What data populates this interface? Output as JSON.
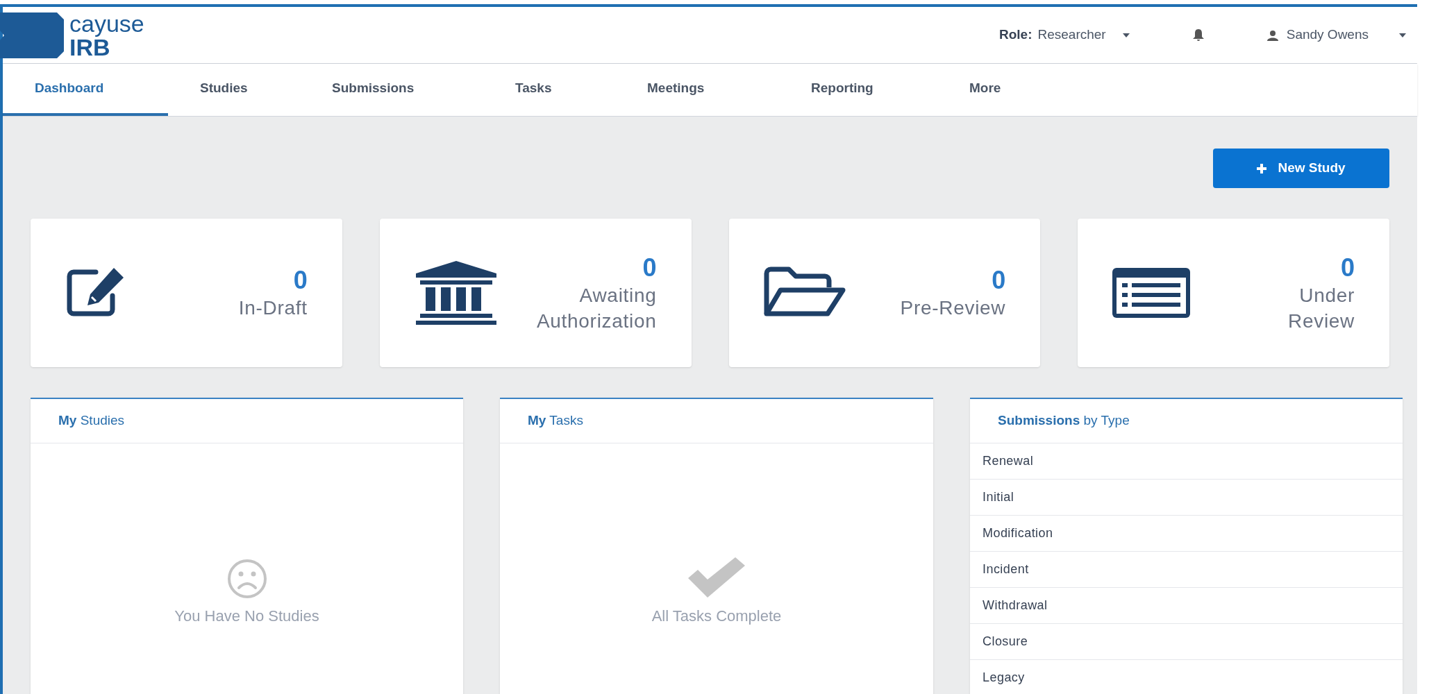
{
  "logo": {
    "line_1": "cayuse",
    "line_2": "IRB"
  },
  "header": {
    "role_label": "Role:",
    "role_value": "Researcher",
    "user_name": "Sandy Owens"
  },
  "tabs": [
    {
      "label": "Dashboard",
      "selected": true
    },
    {
      "label": "Studies",
      "selected": false
    },
    {
      "label": "Submissions",
      "selected": false
    },
    {
      "label": "Tasks",
      "selected": false
    },
    {
      "label": "Meetings",
      "selected": false
    },
    {
      "label": "Reporting",
      "selected": false
    },
    {
      "label": "More",
      "selected": false
    }
  ],
  "new_study_button": {
    "label": "New Study"
  },
  "stat_cards": [
    {
      "kind": "draft",
      "count": "0",
      "label": "In-Draft"
    },
    {
      "kind": "authorization",
      "count": "0",
      "label": "Awaiting Authorization"
    },
    {
      "kind": "prereview",
      "count": "0",
      "label": "Pre-Review"
    },
    {
      "kind": "review",
      "count": "0",
      "label": "Under Review"
    }
  ],
  "panels": [
    {
      "kind": "empty_studies",
      "title": "**My** Studies",
      "message": "You Have No Studies"
    },
    {
      "kind": "empty_tasks",
      "title": "**My** Tasks",
      "message": "All Tasks Complete"
    },
    {
      "kind": "list",
      "title": "**Submissions** by Type",
      "items": [
        "Renewal",
        "Initial",
        "Modification",
        "Incident",
        "Withdrawal",
        "Closure",
        "Legacy"
      ]
    }
  ]
}
